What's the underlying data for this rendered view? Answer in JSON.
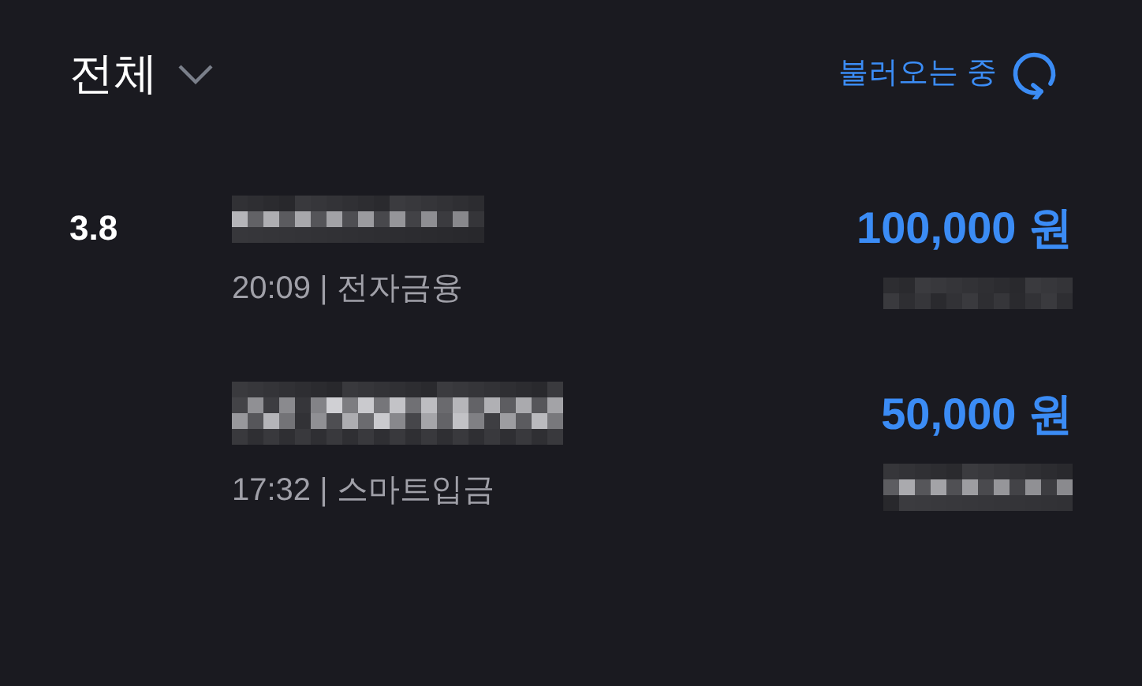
{
  "header": {
    "filter": "전체",
    "status": "불러오는 중"
  },
  "days": [
    {
      "date": "3.8",
      "transactions": [
        {
          "time_and_method": "20:09 | 전자금융",
          "amount": "100,000 원"
        },
        {
          "time_and_method": "17:32 | 스마트입금",
          "amount": "50,000 원"
        }
      ]
    }
  ]
}
